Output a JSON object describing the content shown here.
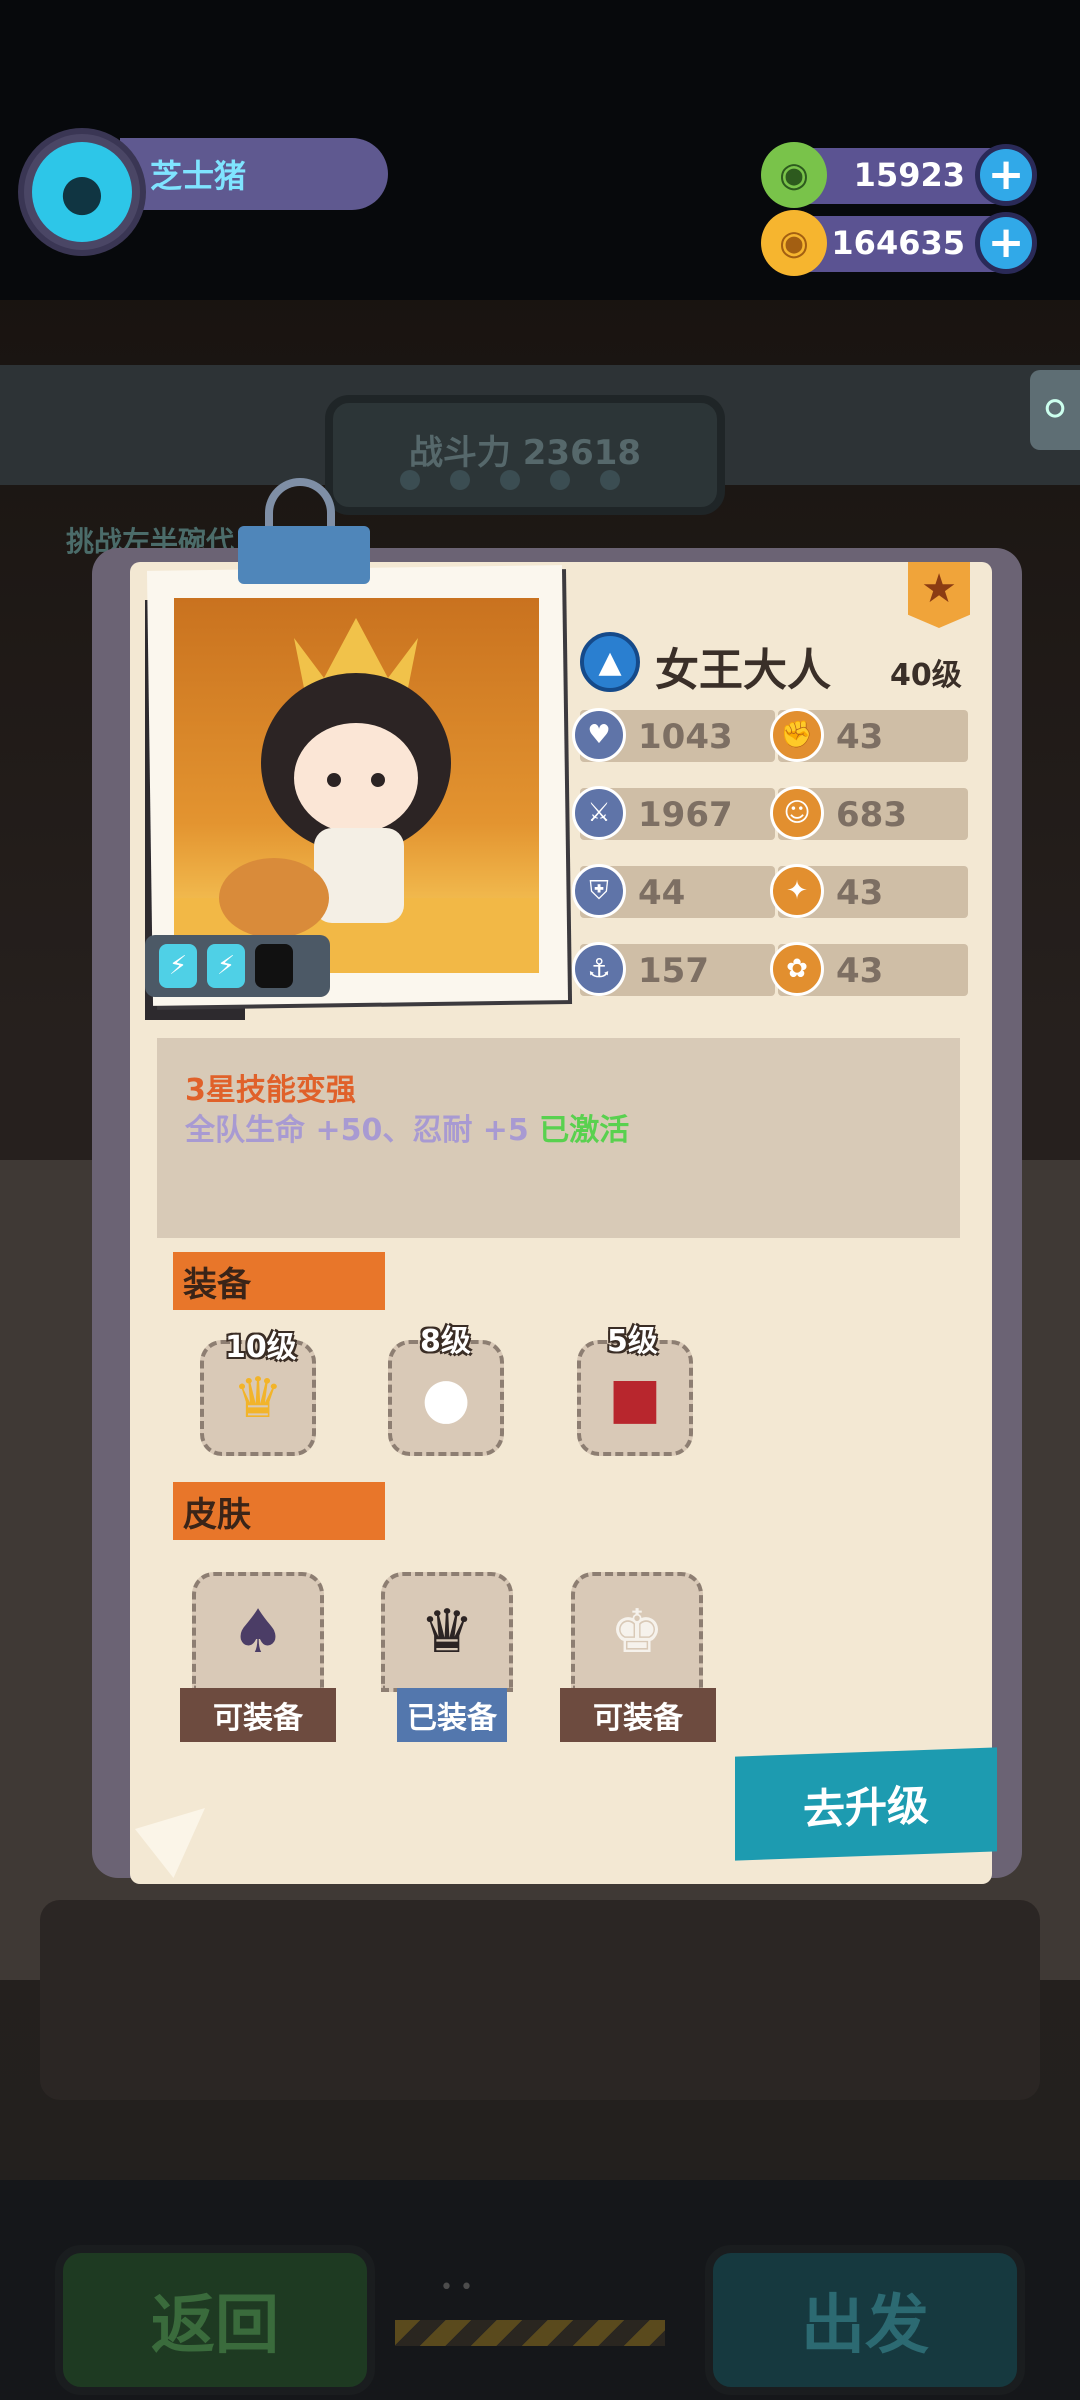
{
  "player": {
    "name": "芝士猪",
    "avatar_icon": "cat-face-icon"
  },
  "currencies": [
    {
      "name": "green-gem",
      "value": "15923",
      "icon": "green-coin-icon"
    },
    {
      "name": "gold-planet",
      "value": "164635",
      "icon": "planet-coin-icon"
    }
  ],
  "background": {
    "power_label": "战斗力 23618",
    "challenge_text": "挑战左半碗代",
    "back_label": "返回",
    "go_label": "出发"
  },
  "hero": {
    "name": "女王大人",
    "level": "40级",
    "stats": [
      {
        "icon": "heart-shield-icon",
        "value": "1043",
        "color": "blue"
      },
      {
        "icon": "fist-icon",
        "value": "43",
        "color": "orange"
      },
      {
        "icon": "sword-shield-icon",
        "value": "1967",
        "color": "blue"
      },
      {
        "icon": "smile-icon",
        "value": "683",
        "color": "orange"
      },
      {
        "icon": "shield-icon",
        "value": "44",
        "color": "blue"
      },
      {
        "icon": "muscle-icon",
        "value": "43",
        "color": "orange"
      },
      {
        "icon": "anchor-shield-icon",
        "value": "157",
        "color": "blue"
      },
      {
        "icon": "brain-icon",
        "value": "43",
        "color": "orange"
      }
    ]
  },
  "skill": {
    "title": "3星技能变强",
    "desc": "全队生命 +50、忍耐 +5 ",
    "status": "已激活"
  },
  "equipment": {
    "tab_label": "装备",
    "items": [
      {
        "level": "10级",
        "icon": "crown-icon"
      },
      {
        "level": "8级",
        "icon": "white-pet-icon"
      },
      {
        "level": "5级",
        "icon": "red-cloak-pet-icon"
      }
    ]
  },
  "skins": {
    "tab_label": "皮肤",
    "items": [
      {
        "button": "可装备",
        "state": "available",
        "icon": "dark-queen-skin-icon"
      },
      {
        "button": "已装备",
        "state": "equipped",
        "icon": "queen-skin-icon"
      },
      {
        "button": "可装备",
        "state": "available",
        "icon": "white-king-skin-icon"
      }
    ]
  },
  "upgrade_label": "去升级"
}
